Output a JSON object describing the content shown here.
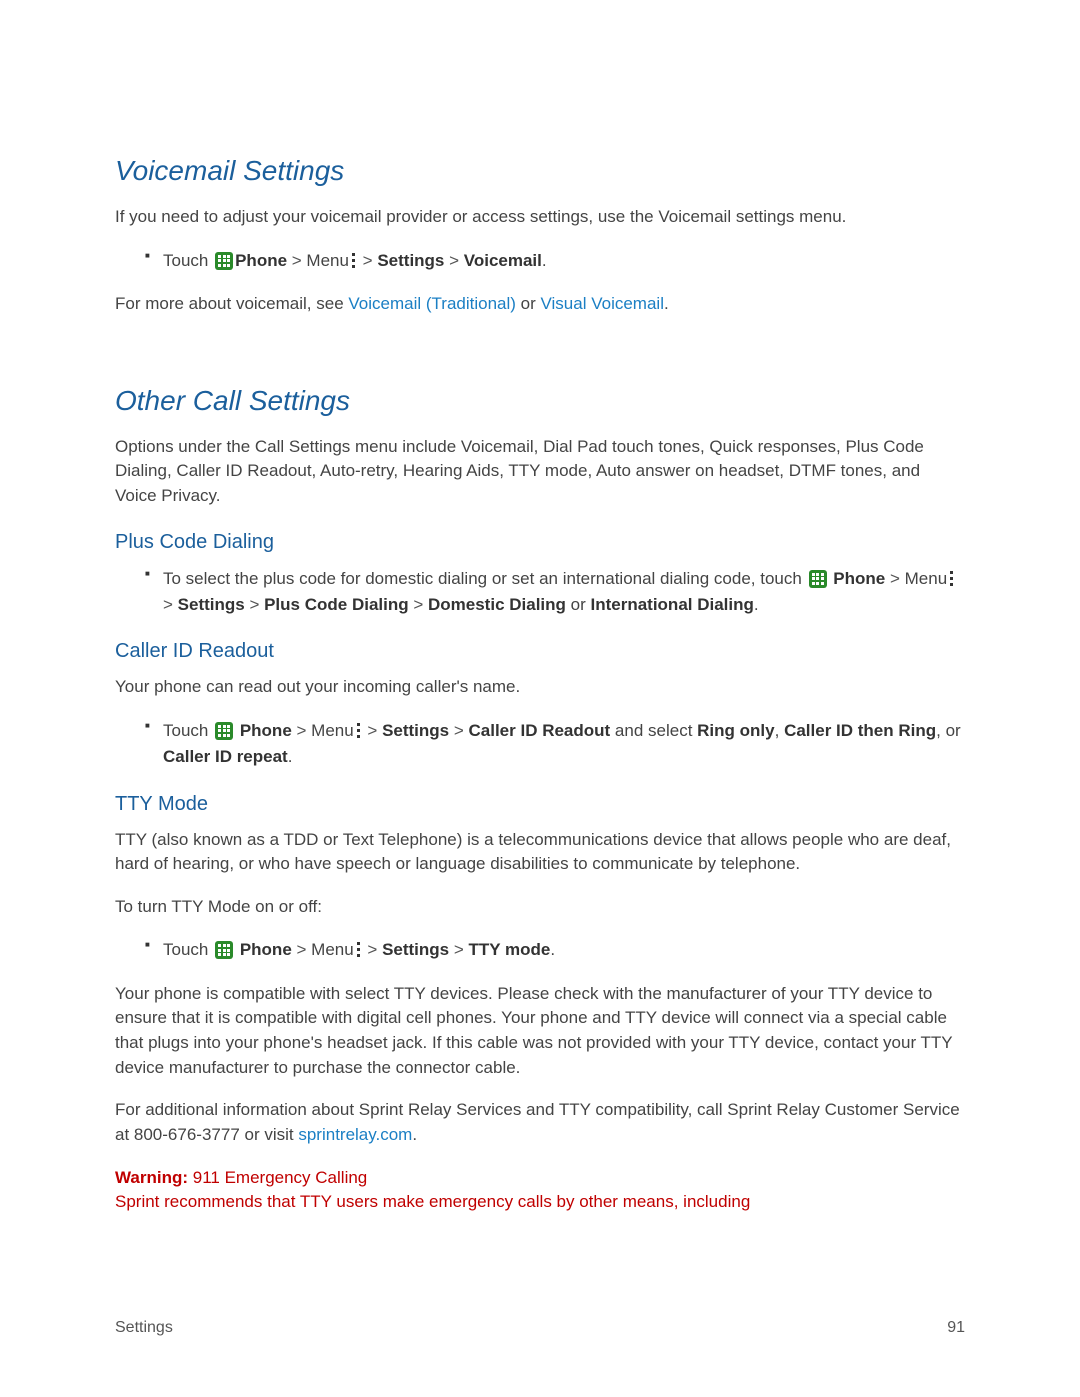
{
  "section1": {
    "title": "Voicemail Settings",
    "intro": "If you need to adjust your voicemail provider or access settings, use the Voicemail settings menu.",
    "bullet": {
      "touch": "Touch ",
      "phone": "Phone",
      "gt1": " > ",
      "menu": "Menu",
      "gt2": " > ",
      "settings": "Settings",
      "gt3": " > ",
      "voicemail": "Voicemail",
      "period": "."
    },
    "more": {
      "pre": "For more about voicemail, see ",
      "link1": "Voicemail (Traditional)",
      "mid": " or ",
      "link2": "Visual Voicemail",
      "post": "."
    }
  },
  "section2": {
    "title": "Other Call Settings",
    "intro": "Options under the Call Settings menu include Voicemail, Dial Pad touch tones, Quick responses, Plus Code Dialing, Caller ID Readout, Auto-retry, Hearing Aids, TTY mode, Auto answer on headset, DTMF tones, and Voice Privacy.",
    "plus": {
      "heading": "Plus Code Dialing",
      "bullet": {
        "pre": "To select the plus code for domestic dialing or set an international dialing code, touch ",
        "phone": "Phone",
        "gt1": " > ",
        "menu": "Menu",
        "gt2": " > ",
        "settings": "Settings",
        "gt3": "  > ",
        "pcd": "Plus Code Dialing",
        "gt4": " >  ",
        "dd": "Domestic Dialing",
        "or": " or ",
        "id": "International Dialing",
        "period": "."
      }
    },
    "caller": {
      "heading": "Caller ID Readout",
      "intro": "Your phone can read out your incoming caller's name.",
      "bullet": {
        "touch": "Touch ",
        "phone": "Phone",
        "gt1": " > ",
        "menu": "Menu",
        "gt2": " > ",
        "settings": "Settings",
        "gt3": " > ",
        "cir": "Caller ID Readout",
        "sel": " and select ",
        "ro": "Ring only",
        "c1": ", ",
        "citr": "Caller ID then Ring",
        "c2": ", or ",
        "cirr": "Caller ID repeat",
        "period": "."
      }
    },
    "tty": {
      "heading": "TTY Mode",
      "p1": "TTY (also known as a TDD or Text Telephone) is a telecommunications device that allows people who are deaf, hard of hearing, or who have speech or language disabilities to communicate by telephone.",
      "p2": "To turn TTY Mode on or off:",
      "bullet": {
        "touch": "Touch ",
        "phone": "Phone",
        "gt1": " > ",
        "menu": "Menu",
        "gt2": " > ",
        "settings": "Settings",
        "gt3": " > ",
        "ttym": "TTY mode",
        "period": "."
      },
      "p3": "Your phone is compatible with select TTY devices. Please check with the manufacturer of your TTY device to ensure that it is compatible with digital cell phones. Your phone and TTY device will connect via a special cable that plugs into your phone's headset jack. If this cable was not provided with your TTY device, contact your TTY device manufacturer to purchase the connector cable.",
      "p4": {
        "pre": "For additional information about Sprint Relay Services and TTY compatibility, call Sprint Relay Customer Service at 800-676-3777 or visit ",
        "link": "sprintrelay.com",
        "post": "."
      },
      "warning": {
        "label": "Warning:",
        "title": " 911 Emergency Calling",
        "body": "Sprint recommends that TTY users make emergency calls by other means, including"
      }
    }
  },
  "footer": {
    "left": "Settings",
    "right": "91"
  }
}
